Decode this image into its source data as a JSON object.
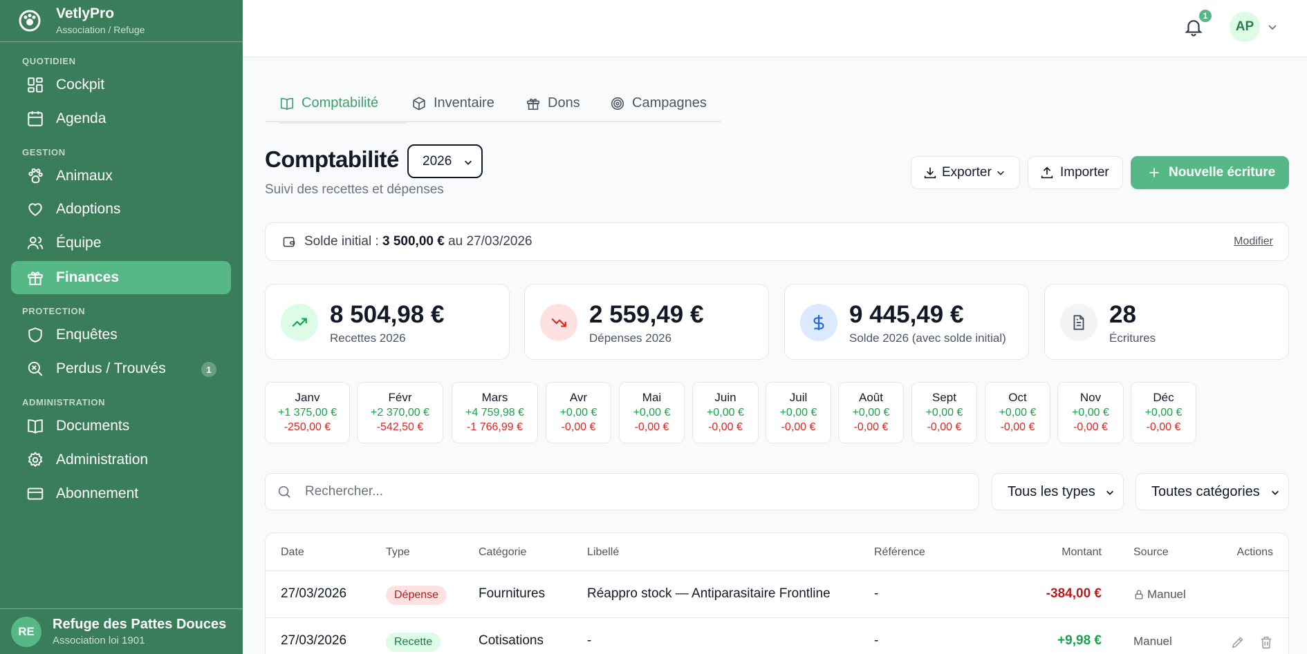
{
  "brand": {
    "name": "VetlyPro",
    "subtitle": "Association / Refuge"
  },
  "sidebar": {
    "sections": [
      {
        "label": "QUOTIDIEN"
      },
      {
        "label": "GESTION"
      },
      {
        "label": "PROTECTION"
      },
      {
        "label": "ADMINISTRATION"
      }
    ],
    "items": [
      {
        "label": "Cockpit",
        "icon": "grid-icon"
      },
      {
        "label": "Agenda",
        "icon": "calendar-icon"
      },
      {
        "label": "Animaux",
        "icon": "paw-icon"
      },
      {
        "label": "Adoptions",
        "icon": "heart-icon"
      },
      {
        "label": "Équipe",
        "icon": "users-icon"
      },
      {
        "label": "Finances",
        "icon": "gift-icon",
        "active": true
      },
      {
        "label": "Enquêtes",
        "icon": "shield-icon"
      },
      {
        "label": "Perdus / Trouvés",
        "icon": "search-alert-icon",
        "badge": "1"
      },
      {
        "label": "Documents",
        "icon": "book-icon"
      },
      {
        "label": "Administration",
        "icon": "gear-icon"
      },
      {
        "label": "Abonnement",
        "icon": "credit-card-icon"
      }
    ],
    "org": {
      "initials": "RE",
      "name": "Refuge des Pattes Douces",
      "subtitle": "Association loi 1901"
    }
  },
  "topbar": {
    "notification_count": "1",
    "user_initials": "AP"
  },
  "tabs": [
    {
      "label": "Comptabilité",
      "icon": "book-open-icon",
      "active": true
    },
    {
      "label": "Inventaire",
      "icon": "box-icon"
    },
    {
      "label": "Dons",
      "icon": "gift-icon"
    },
    {
      "label": "Campagnes",
      "icon": "target-icon"
    }
  ],
  "header": {
    "title": "Comptabilité",
    "year": "2026",
    "subtitle": "Suivi des recettes et dépenses",
    "export_label": "Exporter",
    "import_label": "Importer",
    "new_label": "Nouvelle écriture"
  },
  "balance": {
    "prefix": "Solde initial : ",
    "amount": "3 500,00 €",
    "suffix": " au 27/03/2026",
    "modify_label": "Modifier"
  },
  "stats": [
    {
      "value": "8 504,98 €",
      "label": "Recettes 2026",
      "icon": "trending-up-icon",
      "color": "#16a34a",
      "bg": "#dcfce7"
    },
    {
      "value": "2 559,49 €",
      "label": "Dépenses 2026",
      "icon": "trending-down-icon",
      "color": "#dc2626",
      "bg": "#fee2e2"
    },
    {
      "value": "9 445,49 €",
      "label": "Solde 2026 (avec solde initial)",
      "icon": "dollar-icon",
      "color": "#2563eb",
      "bg": "#dbeafe"
    },
    {
      "value": "28",
      "label": "Écritures",
      "icon": "file-text-icon",
      "color": "#4b5563",
      "bg": "#f3f4f6"
    }
  ],
  "months": [
    {
      "name": "Janv",
      "income": "+1 375,00 €",
      "expense": "-250,00 €"
    },
    {
      "name": "Févr",
      "income": "+2 370,00 €",
      "expense": "-542,50 €"
    },
    {
      "name": "Mars",
      "income": "+4 759,98 €",
      "expense": "-1 766,99 €"
    },
    {
      "name": "Avr",
      "income": "+0,00 €",
      "expense": "-0,00 €"
    },
    {
      "name": "Mai",
      "income": "+0,00 €",
      "expense": "-0,00 €"
    },
    {
      "name": "Juin",
      "income": "+0,00 €",
      "expense": "-0,00 €"
    },
    {
      "name": "Juil",
      "income": "+0,00 €",
      "expense": "-0,00 €"
    },
    {
      "name": "Août",
      "income": "+0,00 €",
      "expense": "-0,00 €"
    },
    {
      "name": "Sept",
      "income": "+0,00 €",
      "expense": "-0,00 €"
    },
    {
      "name": "Oct",
      "income": "+0,00 €",
      "expense": "-0,00 €"
    },
    {
      "name": "Nov",
      "income": "+0,00 €",
      "expense": "-0,00 €"
    },
    {
      "name": "Déc",
      "income": "+0,00 €",
      "expense": "-0,00 €"
    }
  ],
  "filters": {
    "search_placeholder": "Rechercher...",
    "type_selected": "Tous les types",
    "category_selected": "Toutes catégories"
  },
  "table": {
    "columns": [
      "Date",
      "Type",
      "Catégorie",
      "Libellé",
      "Référence",
      "Montant",
      "Source",
      "Actions"
    ],
    "rows": [
      {
        "date": "27/03/2026",
        "type": "Dépense",
        "category": "Fournitures",
        "label": "Réappro stock — Antiparasitaire Frontline",
        "reference": "-",
        "amount": "-384,00 €",
        "source": "Manuel"
      },
      {
        "date": "27/03/2026",
        "type": "Recette",
        "category": "Cotisations",
        "label": "-",
        "reference": "-",
        "amount": "+9,98 €",
        "source": "Manuel"
      }
    ]
  },
  "colors": {
    "sidebar": "#3a7d5a",
    "accent": "#56b887",
    "income": "#16a34a",
    "expense": "#dc2626"
  }
}
